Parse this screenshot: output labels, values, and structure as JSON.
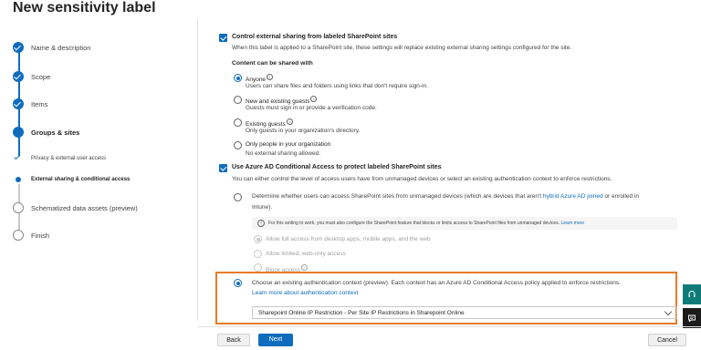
{
  "page": {
    "title": "New sensitivity label"
  },
  "steps": [
    {
      "label": "Name & description",
      "state": "done"
    },
    {
      "label": "Scope",
      "state": "done"
    },
    {
      "label": "Items",
      "state": "done"
    },
    {
      "label": "Groups & sites",
      "state": "current"
    },
    {
      "label": "Privacy & external user access",
      "state": "sub-done"
    },
    {
      "label": "External sharing & conditional access",
      "state": "sub-current"
    },
    {
      "label": "Schematized data assets (preview)",
      "state": "todo"
    },
    {
      "label": "Finish",
      "state": "todo"
    }
  ],
  "sharing": {
    "checkbox_label": "Control external sharing from labeled SharePoint sites",
    "description": "When this label is applied to a SharePoint site, these settings will replace existing external sharing settings configured for the site.",
    "options_heading": "Content can be shared with",
    "options": [
      {
        "label": "Anyone",
        "desc": "Users can share files and folders using links that don't require sign-in.",
        "selected": true
      },
      {
        "label": "New and existing guests",
        "desc": "Guests must sign in or provide a verification code.",
        "selected": false
      },
      {
        "label": "Existing guests",
        "desc": "Only guests in your organization's directory.",
        "selected": false
      },
      {
        "label": "Only people in your organization",
        "desc": "No external sharing allowed.",
        "selected": false
      }
    ]
  },
  "conditional": {
    "checkbox_label": "Use Azure AD Conditional Access to protect labeled SharePoint sites",
    "description": "You can either control the level of access users have from unmanaged devices or select an existing authentication context to enforce restrictions.",
    "unmanaged_option": {
      "text_before": "Determine whether users can access SharePoint sites from unmanaged devices (which are devices that aren't ",
      "link": "hybrid Azure AD joined",
      "text_after": " or enrolled in",
      "text_line2": "Intune)."
    },
    "notice": {
      "text": "For this setting to work, you must also configure the SharePoint feature that blocks or limits access to SharePoint files from unmanaged devices.",
      "link": "Learn more"
    },
    "sub_options": [
      "Allow full access from desktop apps, mobile apps, and the web",
      "Allow limited, web-only access",
      "Block access"
    ],
    "auth_context_option": {
      "text": "Choose an existing authentication context (preview). Each context has an Azure AD Conditional Access policy applied to enforce restrictions.",
      "link": "Learn more about authentication context"
    },
    "dropdown_value": "Sharepoint Online IP Restriction - Per Site IP Restrictions in Sharepoint Online"
  },
  "footer": {
    "back": "Back",
    "next": "Next",
    "cancel": "Cancel"
  },
  "colors": {
    "accent": "#0f6cbd",
    "highlight": "#ea7b28",
    "teal": "#0f7b78"
  }
}
